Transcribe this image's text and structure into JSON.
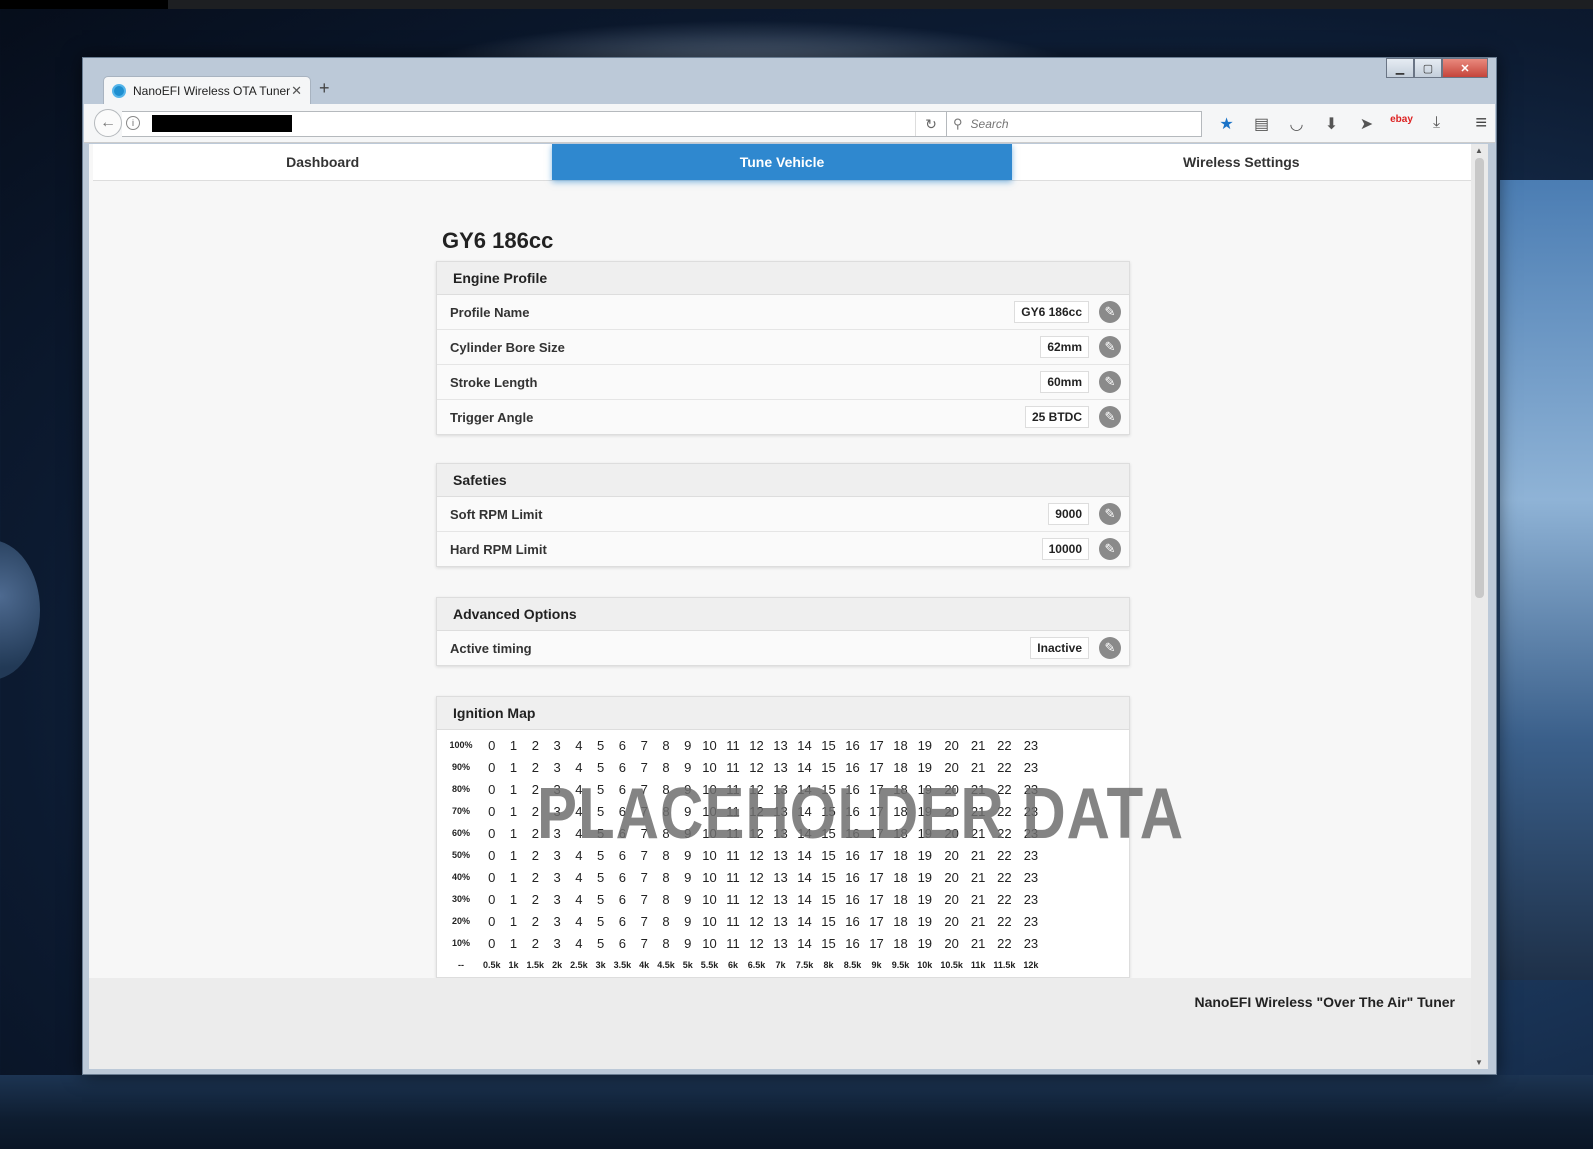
{
  "browser": {
    "tab_title": "NanoEFI Wireless OTA Tuner",
    "tab_close": "✕",
    "new_tab": "+",
    "search_placeholder": "Search"
  },
  "site_nav": [
    "Dashboard",
    "Tune Vehicle",
    "Wireless Settings"
  ],
  "page_title": "GY6 186cc",
  "engine_profile": {
    "title": "Engine Profile",
    "rows": [
      {
        "label": "Profile Name",
        "value": "GY6 186cc"
      },
      {
        "label": "Cylinder Bore Size",
        "value": "62mm"
      },
      {
        "label": "Stroke Length",
        "value": "60mm"
      },
      {
        "label": "Trigger Angle",
        "value": "25 BTDC"
      }
    ]
  },
  "safeties": {
    "title": "Safeties",
    "rows": [
      {
        "label": "Soft RPM Limit",
        "value": "9000"
      },
      {
        "label": "Hard RPM Limit",
        "value": "10000"
      }
    ]
  },
  "advanced": {
    "title": "Advanced Options",
    "rows": [
      {
        "label": "Active timing",
        "value": "Inactive"
      }
    ]
  },
  "ignition": {
    "title": "Ignition Map",
    "row_labels": [
      "100%",
      "90%",
      "80%",
      "70%",
      "60%",
      "50%",
      "40%",
      "30%",
      "20%",
      "10%"
    ],
    "cells": [
      "0",
      "1",
      "2",
      "3",
      "4",
      "5",
      "6",
      "7",
      "8",
      "9",
      "10",
      "11",
      "12",
      "13",
      "14",
      "15",
      "16",
      "17",
      "18",
      "19",
      "20",
      "21",
      "22",
      "23"
    ],
    "corner": "--",
    "rpm_labels": [
      "0.5k",
      "1k",
      "1.5k",
      "2k",
      "2.5k",
      "3k",
      "3.5k",
      "4k",
      "4.5k",
      "5k",
      "5.5k",
      "6k",
      "6.5k",
      "7k",
      "7.5k",
      "8k",
      "8.5k",
      "9k",
      "9.5k",
      "10k",
      "10.5k",
      "11k",
      "11.5k",
      "12k"
    ],
    "watermark": "PLACEHOLDER DATA"
  },
  "footer": "NanoEFI Wireless \"Over The Air\" Tuner"
}
